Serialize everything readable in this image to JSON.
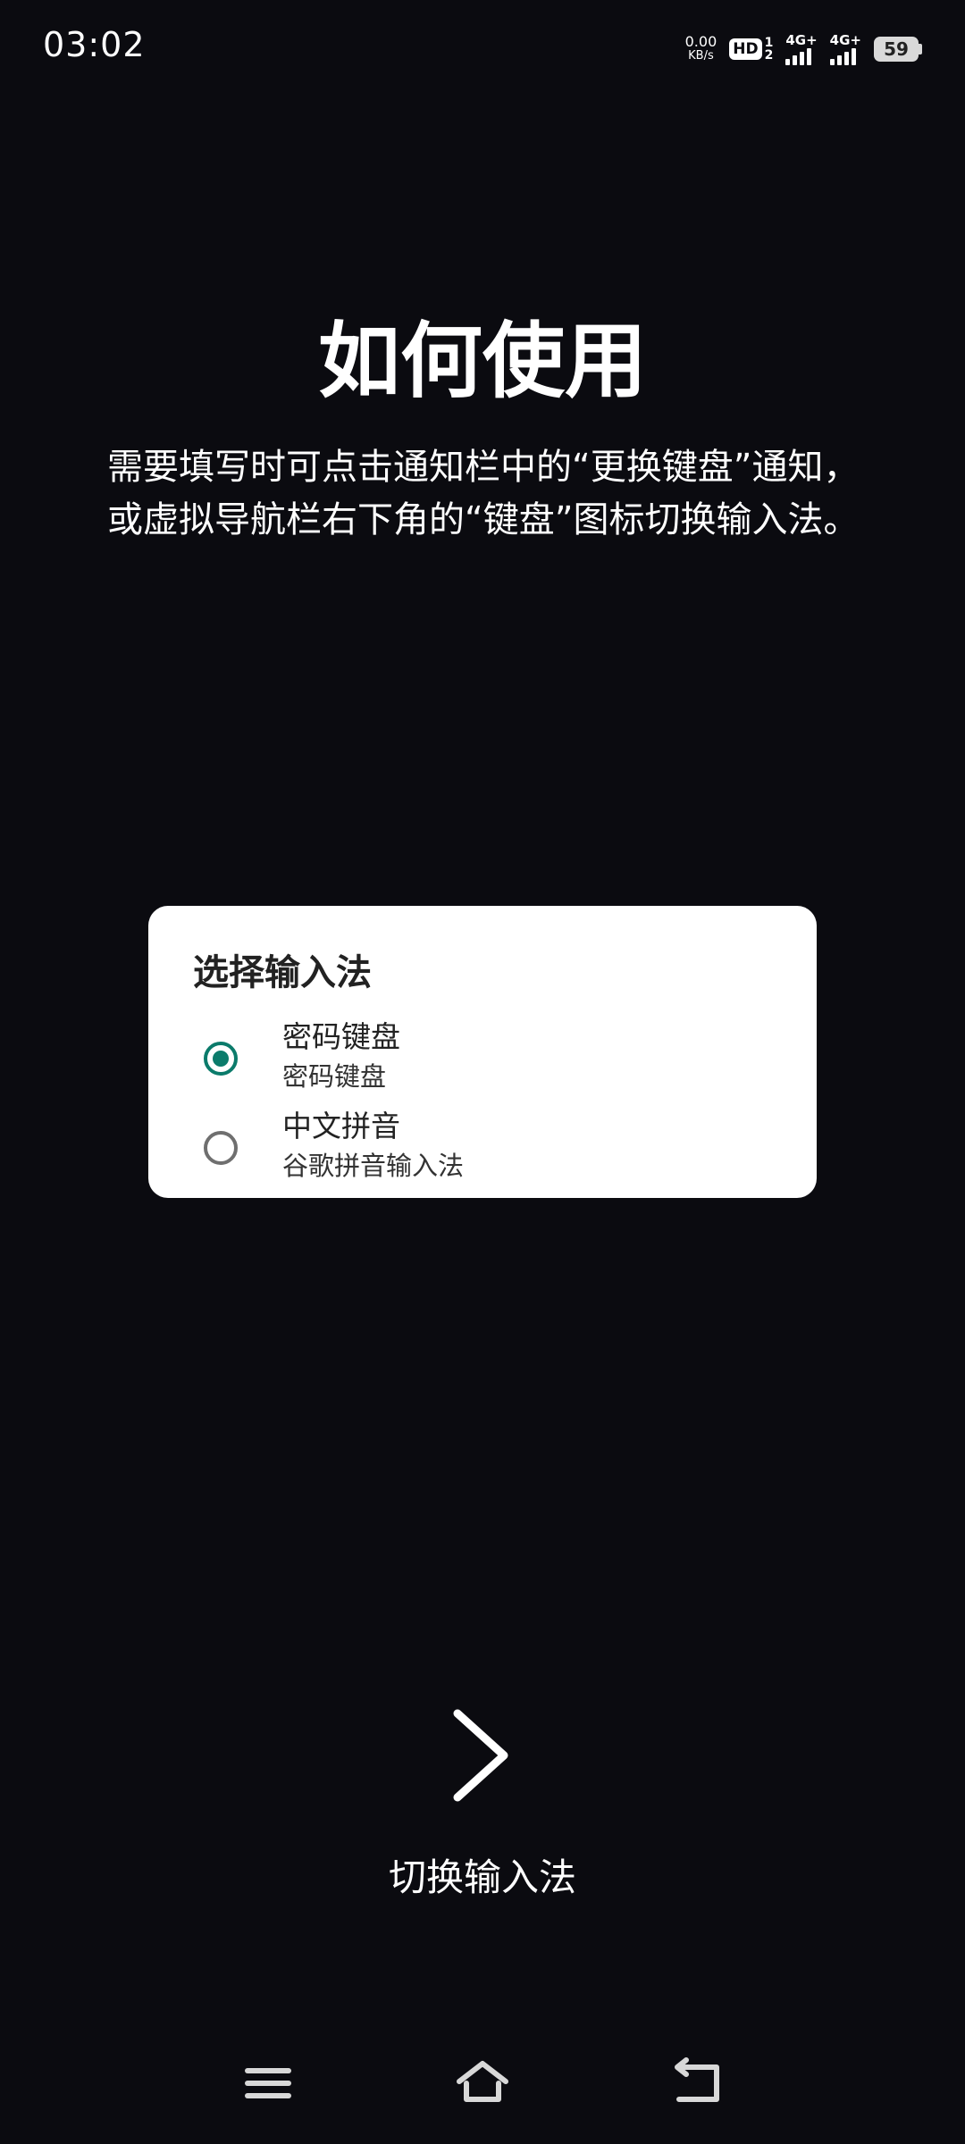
{
  "status_bar": {
    "time": "03:02",
    "net_speed": "0.00",
    "net_speed_unit": "KB/s",
    "hd_label": "HD",
    "hd_sim_top": "1",
    "hd_sim_bottom": "2",
    "sim1_network": "4G+",
    "sim2_network": "4G+",
    "battery_level": "59"
  },
  "main": {
    "title": "如何使用",
    "instructions": "需要填写时可点击通知栏中的“更换键盘”通知，或虚拟导航栏右下角的“键盘”图标切换输入法。"
  },
  "dialog": {
    "title": "选择输入法",
    "options": [
      {
        "title": "密码键盘",
        "subtitle": "密码键盘",
        "selected": true
      },
      {
        "title": "中文拼音",
        "subtitle": "谷歌拼音输入法",
        "selected": false
      }
    ]
  },
  "action": {
    "icon": "chevron-right-icon",
    "label": "切换输入法"
  },
  "nav_bar": {
    "icons": [
      "menu-icon",
      "home-icon",
      "back-icon"
    ]
  },
  "colors": {
    "background": "#0b0b10",
    "accent": "#0b7b6b",
    "dialog_bg": "#ffffff"
  }
}
